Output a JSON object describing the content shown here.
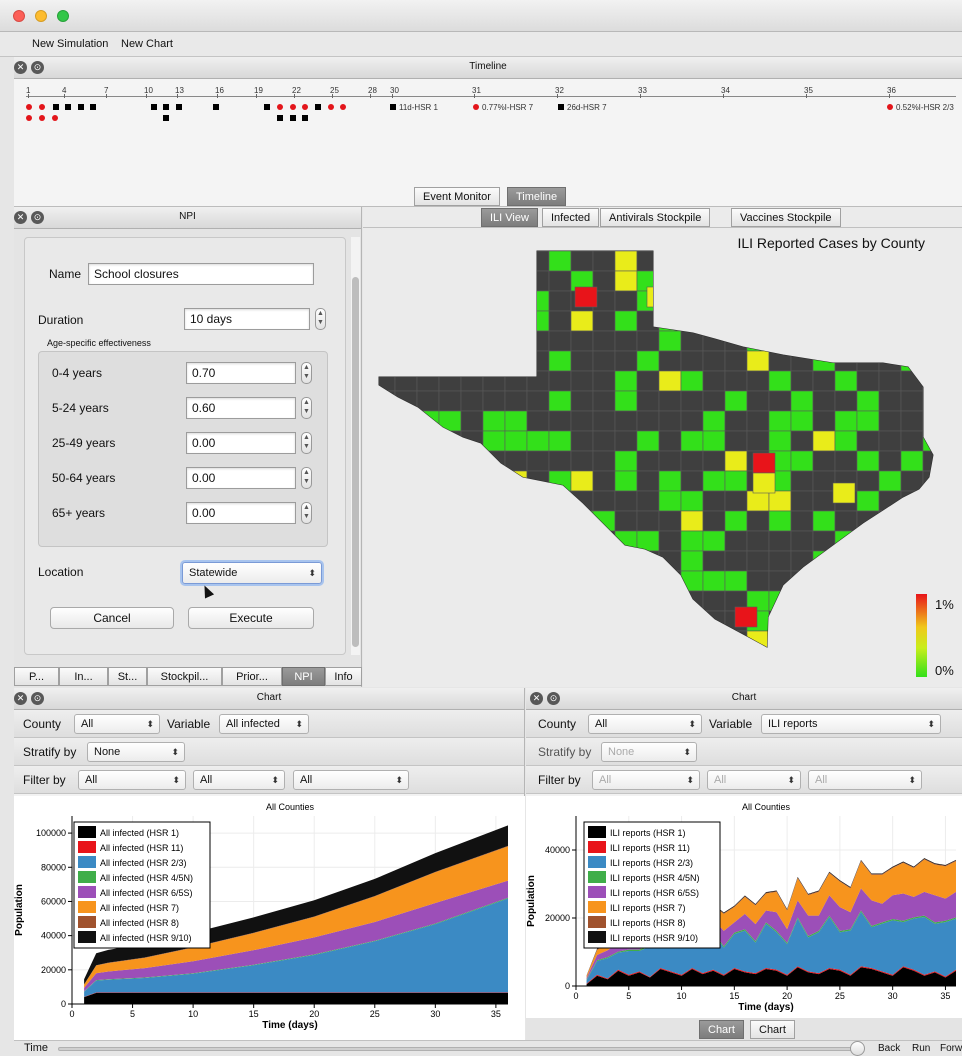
{
  "window": {
    "title": ""
  },
  "menu": {
    "new_simulation": "New Simulation",
    "new_chart": "New Chart"
  },
  "timeline": {
    "title": "Timeline",
    "ticks": [
      "1",
      "4",
      "7",
      "10",
      "13",
      "16",
      "19",
      "22",
      "25",
      "28",
      "30",
      "31",
      "32",
      "33",
      "34",
      "35",
      "36"
    ],
    "events": [
      {
        "label": "11d-HSR 1",
        "icon": "square"
      },
      {
        "label": "0.77%I-HSR 7",
        "icon": "dot"
      },
      {
        "label": "26d-HSR 7",
        "icon": "square"
      },
      {
        "label": "0.52%I-HSR 2/3",
        "icon": "dot"
      }
    ],
    "tabs": [
      "Event Monitor",
      "Timeline"
    ],
    "selected_tab": "Timeline"
  },
  "npi": {
    "title": "NPI",
    "name_label": "Name",
    "name_value": "School closures",
    "duration_label": "Duration",
    "duration_value": "10 days",
    "age_group_title": "Age-specific effectiveness",
    "ages": [
      {
        "label": "0-4 years",
        "value": "0.70"
      },
      {
        "label": "5-24 years",
        "value": "0.60"
      },
      {
        "label": "25-49 years",
        "value": "0.00"
      },
      {
        "label": "50-64 years",
        "value": "0.00"
      },
      {
        "label": "65+ years",
        "value": "0.00"
      }
    ],
    "location_label": "Location",
    "location_value": "Statewide",
    "cancel": "Cancel",
    "execute": "Execute",
    "bottom_tabs": [
      "P...",
      "In...",
      "St...",
      "Stockpil...",
      "Prior...",
      "NPI",
      "Info"
    ],
    "selected_tab": "NPI"
  },
  "map": {
    "tabs": [
      "ILI View",
      "Infected",
      "Antivirals Stockpile",
      "Vaccines Stockpile"
    ],
    "selected_tab": "ILI View",
    "title": "ILI Reported Cases by County",
    "legend_high": "1%",
    "legend_low": "0%",
    "colors": {
      "none": "#3f3f3f",
      "low": "#33e01a",
      "mid": "#e9ec1a",
      "high": "#e8141a"
    }
  },
  "left_chart": {
    "title": "Chart",
    "county_label": "County",
    "county_value": "All",
    "variable_label": "Variable",
    "variable_value": "All infected",
    "stratify_label": "Stratify by",
    "stratify_value": "None",
    "filter_label": "Filter by",
    "filter_values": [
      "All",
      "All",
      "All"
    ]
  },
  "right_chart": {
    "title": "Chart",
    "county_label": "County",
    "county_value": "All",
    "variable_label": "Variable",
    "variable_value": "ILI reports",
    "stratify_label": "Stratify by",
    "stratify_value": "None",
    "filter_label": "Filter by",
    "filter_values": [
      "All",
      "All",
      "All"
    ],
    "bottom_tabs": [
      "Chart",
      "Chart"
    ],
    "selected_tab": 0
  },
  "chart_data": [
    {
      "type": "area",
      "title": "All Counties",
      "xlabel": "Time (days)",
      "ylabel": "Population",
      "xlim": [
        0,
        36
      ],
      "ylim": [
        0,
        110000
      ],
      "xticks": [
        0,
        5,
        10,
        15,
        20,
        25,
        30,
        35
      ],
      "yticks": [
        0,
        20000,
        40000,
        60000,
        80000,
        100000
      ],
      "stacked": true,
      "legend_position": "top-left",
      "x": [
        1,
        2,
        3,
        6,
        10,
        15,
        20,
        25,
        30,
        36
      ],
      "series": [
        {
          "name": "All infected (HSR 1)",
          "color": "#000000",
          "values": [
            4000,
            6500,
            6500,
            6500,
            6500,
            6500,
            6500,
            6500,
            6500,
            6500
          ]
        },
        {
          "name": "All infected (HSR 11)",
          "color": "#e8141a",
          "values": [
            200,
            200,
            200,
            200,
            200,
            200,
            200,
            200,
            200,
            200
          ]
        },
        {
          "name": "All infected (HSR 2/3)",
          "color": "#3b8ac4",
          "values": [
            3000,
            7000,
            7500,
            8500,
            11000,
            16000,
            22000,
            30000,
            40000,
            55000
          ]
        },
        {
          "name": "All infected (HSR 4/5N)",
          "color": "#3fae49",
          "values": [
            200,
            300,
            300,
            300,
            300,
            300,
            300,
            300,
            400,
            500
          ]
        },
        {
          "name": "All infected (HSR 6/5S)",
          "color": "#9c4fb8",
          "values": [
            2000,
            4000,
            4500,
            5500,
            7000,
            8500,
            10000,
            11000,
            12000,
            10000
          ]
        },
        {
          "name": "All infected (HSR 7)",
          "color": "#f7941d",
          "values": [
            2000,
            4500,
            5000,
            6000,
            8000,
            10000,
            12000,
            15000,
            18000,
            20000
          ]
        },
        {
          "name": "All infected (HSR 8)",
          "color": "#a0522d",
          "values": [
            100,
            200,
            200,
            200,
            200,
            200,
            200,
            200,
            200,
            300
          ]
        },
        {
          "name": "All infected (HSR 9/10)",
          "color": "#111111",
          "values": [
            3000,
            7000,
            7500,
            8000,
            8500,
            9000,
            9500,
            10000,
            11000,
            12000
          ]
        }
      ]
    },
    {
      "type": "area",
      "title": "All Counties",
      "xlabel": "Time (days)",
      "ylabel": "Population",
      "xlim": [
        0,
        36
      ],
      "ylim": [
        0,
        50000
      ],
      "xticks": [
        0,
        5,
        10,
        15,
        20,
        25,
        30,
        35
      ],
      "yticks": [
        0,
        20000,
        40000
      ],
      "stacked": true,
      "legend_position": "top-left",
      "x": [
        1,
        2,
        3,
        4,
        5,
        6,
        7,
        8,
        9,
        10,
        11,
        12,
        13,
        14,
        15,
        16,
        17,
        18,
        19,
        20,
        21,
        22,
        23,
        24,
        25,
        26,
        27,
        28,
        29,
        30,
        31,
        32,
        33,
        34,
        35,
        36
      ],
      "series": [
        {
          "name": "ILI reports (HSR 1)",
          "color": "#000000",
          "values": [
            500,
            3000,
            2000,
            4500,
            3000,
            4000,
            2500,
            5000,
            4000,
            3000,
            5000,
            3500,
            4500,
            3000,
            5000,
            4000,
            3500,
            5000,
            4500,
            3000,
            5500,
            4000,
            3500,
            5000,
            4500,
            3000,
            5500,
            5000,
            4000,
            3000,
            5500,
            4500,
            3000,
            4000,
            2500,
            4500
          ]
        },
        {
          "name": "ILI reports (HSR 11)",
          "color": "#e8141a",
          "values": [
            200,
            300,
            200,
            300,
            300,
            300,
            200,
            300,
            300,
            300,
            300,
            300,
            300,
            300,
            300,
            300,
            300,
            300,
            300,
            300,
            300,
            300,
            300,
            300,
            300,
            300,
            300,
            300,
            300,
            300,
            300,
            300,
            300,
            300,
            300,
            300
          ]
        },
        {
          "name": "ILI reports (HSR 2/3)",
          "color": "#3b8ac4",
          "values": [
            1000,
            4000,
            6000,
            5000,
            7000,
            6000,
            9000,
            7000,
            8000,
            10000,
            7000,
            9000,
            11000,
            8000,
            10000,
            12000,
            9000,
            13000,
            11000,
            9000,
            14000,
            10000,
            12000,
            15000,
            11000,
            13000,
            16000,
            12000,
            14000,
            16000,
            13000,
            15000,
            17000,
            14000,
            16000,
            15000
          ]
        },
        {
          "name": "ILI reports (HSR 4/5N)",
          "color": "#3fae49",
          "values": [
            200,
            300,
            300,
            300,
            400,
            400,
            400,
            400,
            400,
            400,
            400,
            400,
            400,
            400,
            400,
            400,
            400,
            400,
            400,
            400,
            400,
            400,
            400,
            400,
            400,
            400,
            400,
            400,
            400,
            400,
            400,
            400,
            400,
            400,
            400,
            400
          ]
        },
        {
          "name": "ILI reports (HSR 6/5S)",
          "color": "#9c4fb8",
          "values": [
            500,
            1500,
            2000,
            2500,
            2000,
            3000,
            2500,
            3000,
            3500,
            2500,
            4000,
            3000,
            3500,
            4500,
            3000,
            4500,
            5000,
            3500,
            5500,
            4000,
            5000,
            6000,
            4500,
            6000,
            7000,
            5000,
            6500,
            7500,
            5500,
            7000,
            8000,
            6000,
            7000,
            8000,
            6500,
            7500
          ]
        },
        {
          "name": "ILI reports (HSR 7)",
          "color": "#f7941d",
          "values": [
            500,
            1500,
            2000,
            2500,
            3000,
            2500,
            3000,
            3500,
            3000,
            4000,
            3500,
            4500,
            4000,
            5000,
            4500,
            5000,
            5500,
            5000,
            6000,
            5500,
            6500,
            6000,
            7000,
            6500,
            7500,
            7000,
            8000,
            7500,
            8500,
            8000,
            9000,
            8500,
            9500,
            9000,
            9500,
            9000
          ]
        },
        {
          "name": "ILI reports (HSR 8)",
          "color": "#a0522d",
          "values": [
            100,
            200,
            200,
            200,
            200,
            200,
            200,
            200,
            200,
            200,
            200,
            200,
            200,
            200,
            200,
            200,
            200,
            200,
            200,
            200,
            200,
            200,
            200,
            200,
            200,
            200,
            200,
            200,
            200,
            200,
            200,
            200,
            200,
            200,
            200,
            200
          ]
        },
        {
          "name": "ILI reports (HSR 9/10)",
          "color": "#111111",
          "values": [
            100,
            200,
            200,
            200,
            200,
            200,
            200,
            200,
            200,
            200,
            200,
            200,
            200,
            200,
            200,
            200,
            200,
            200,
            200,
            200,
            200,
            200,
            200,
            200,
            200,
            200,
            200,
            200,
            200,
            200,
            200,
            200,
            200,
            200,
            200,
            200
          ]
        }
      ]
    }
  ],
  "status": {
    "time_label": "Time",
    "back": "Back",
    "run": "Run",
    "forward": "Forward"
  }
}
